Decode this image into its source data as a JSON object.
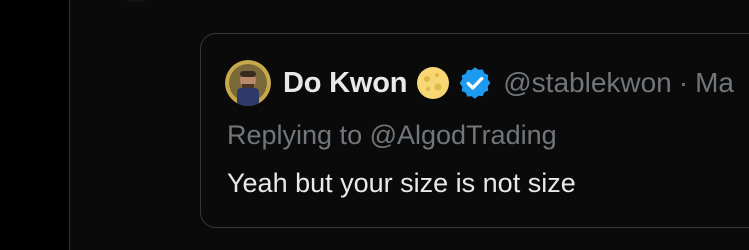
{
  "quote": {
    "author": {
      "display_name": "Do Kwon",
      "handle": "@stablekwon",
      "separator": "·",
      "date": "Ma",
      "verified": true,
      "avatar_icon": "avatar",
      "name_emoji_icon": "moon-icon",
      "verified_icon": "verified-badge-icon"
    },
    "replying_prefix": "Replying to",
    "replying_to": "@AlgodTrading",
    "text": "Yeah but your size is not size"
  },
  "colors": {
    "background": "#0a0a0a",
    "sidebar": "#000000",
    "border": "#333639",
    "primary_text": "#e7e9ea",
    "secondary_text": "#71767b",
    "verified_blue": "#1d9bf0",
    "moon": "#f7d774"
  }
}
